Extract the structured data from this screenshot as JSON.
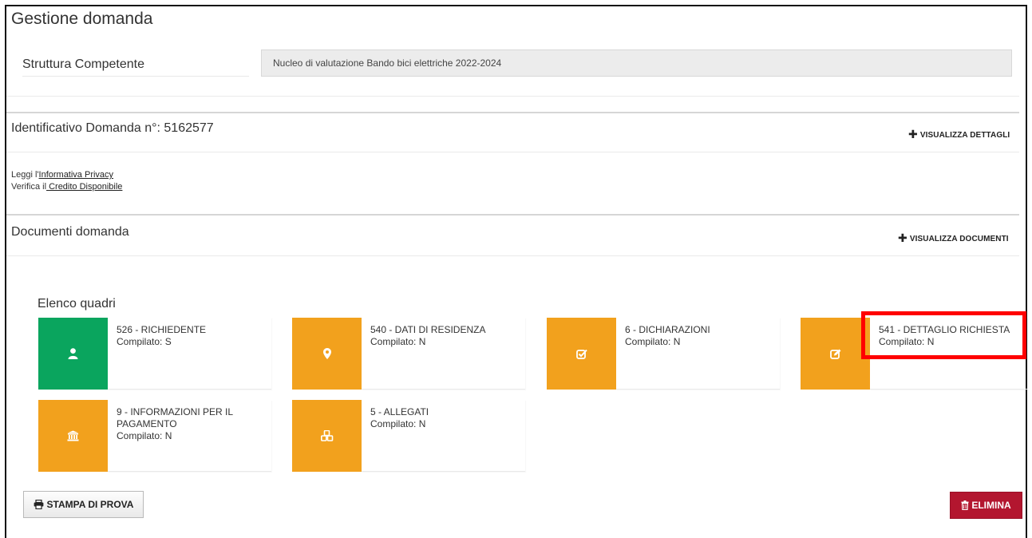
{
  "header": {
    "title": "Gestione domanda"
  },
  "struttura": {
    "label": "Struttura Competente",
    "value": "Nucleo di valutazione Bando bici elettriche 2022-2024"
  },
  "identificativo": {
    "title": "Identificativo Domanda n°: 5162577",
    "toggle_label": "VISUALIZZA DETTAGLI",
    "toggle_icon": "plus-icon"
  },
  "info": {
    "privacy_prefix": "Leggi l'",
    "privacy_link": "Informativa Privacy",
    "credito_prefix": "Verifica il",
    "credito_link": " Credito Disponibile"
  },
  "documenti": {
    "title": "Documenti domanda",
    "toggle_label": "VISUALIZZA DOCUMENTI",
    "toggle_icon": "plus-icon"
  },
  "quadri": {
    "title": "Elenco quadri",
    "items": [
      {
        "name": "526 - RICHIEDENTE",
        "status": "Compilato: S",
        "color": "#0aa55e",
        "icon": "user-icon"
      },
      {
        "name": "540 - DATI DI RESIDENZA",
        "status": "Compilato: N",
        "color": "#f2a11d",
        "icon": "map-marker-icon"
      },
      {
        "name": "6 - DICHIARAZIONI",
        "status": "Compilato: N",
        "color": "#f2a11d",
        "icon": "check-square-icon"
      },
      {
        "name": "541 - DETTAGLIO RICHIESTA",
        "status": "Compilato: N",
        "color": "#f2a11d",
        "icon": "edit-icon"
      },
      {
        "name": "9 - INFORMAZIONI PER IL PAGAMENTO",
        "status": "Compilato: N",
        "color": "#f2a11d",
        "icon": "bank-icon"
      },
      {
        "name": "5 - ALLEGATI",
        "status": "Compilato: N",
        "color": "#f2a11d",
        "icon": "cubes-icon"
      }
    ]
  },
  "actions": {
    "print_label": "STAMPA DI PROVA",
    "print_icon": "print-icon",
    "delete_label": "ELIMINA",
    "delete_icon": "trash-icon",
    "delete_color": "#b3162f"
  },
  "highlight_color": "#ff0000"
}
